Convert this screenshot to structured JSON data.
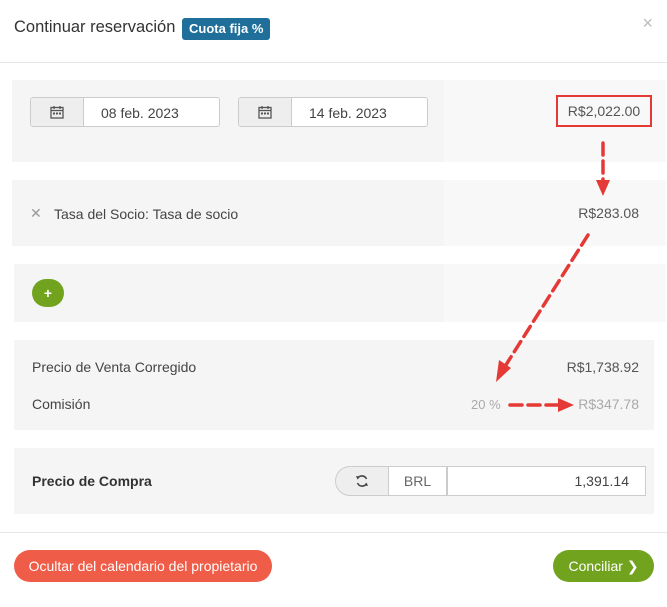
{
  "header": {
    "title": "Continuar reservación",
    "badge": "Cuota fija %",
    "close": "×"
  },
  "dates": {
    "start": "08 feb. 2023",
    "end": "14 feb. 2023"
  },
  "total": "R$2,022.00",
  "fee": {
    "remove": "✕",
    "label": "Tasa del Socio: Tasa de socio",
    "amount": "R$283.08"
  },
  "add_button": "+",
  "pricing": {
    "corrected_label": "Precio de Venta Corregido",
    "corrected_amount": "R$1,738.92",
    "commission_label": "Comisión",
    "commission_percent": "20 %",
    "commission_amount": "R$347.78"
  },
  "purchase": {
    "label": "Precio de Compra",
    "currency": "BRL",
    "value": "1,391.14"
  },
  "footer": {
    "hide_button": "Ocultar del calendario del propietario",
    "reconcile_button": "Conciliar"
  },
  "colors": {
    "accent_blue": "#1f6f9a",
    "green": "#72a31f",
    "red": "#ef5c47",
    "annotation_red": "#e53935"
  }
}
